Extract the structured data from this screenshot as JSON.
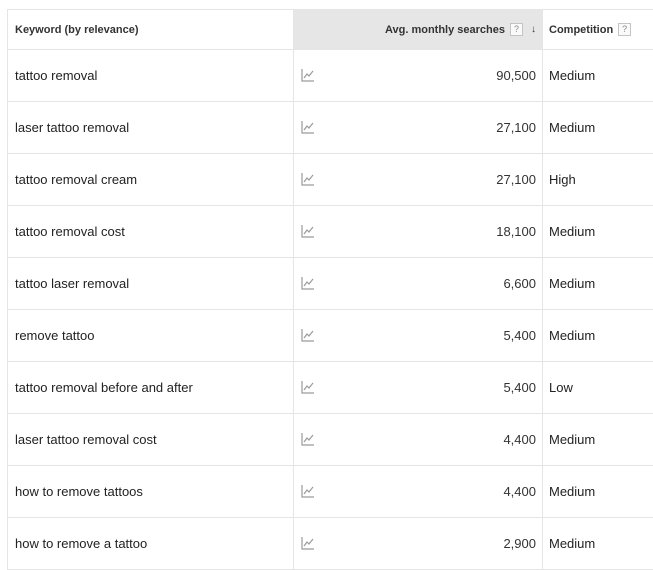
{
  "header": {
    "keyword_col": "Keyword (by relevance)",
    "searches_col": "Avg. monthly searches",
    "competition_col": "Competition",
    "help_glyph": "?",
    "sort_glyph": "↓"
  },
  "rows": [
    {
      "keyword": "tattoo removal",
      "searches": "90,500",
      "competition": "Medium"
    },
    {
      "keyword": "laser tattoo removal",
      "searches": "27,100",
      "competition": "Medium"
    },
    {
      "keyword": "tattoo removal cream",
      "searches": "27,100",
      "competition": "High"
    },
    {
      "keyword": "tattoo removal cost",
      "searches": "18,100",
      "competition": "Medium"
    },
    {
      "keyword": "tattoo laser removal",
      "searches": "6,600",
      "competition": "Medium"
    },
    {
      "keyword": "remove tattoo",
      "searches": "5,400",
      "competition": "Medium"
    },
    {
      "keyword": "tattoo removal before and after",
      "searches": "5,400",
      "competition": "Low"
    },
    {
      "keyword": "laser tattoo removal cost",
      "searches": "4,400",
      "competition": "Medium"
    },
    {
      "keyword": "how to remove tattoos",
      "searches": "4,400",
      "competition": "Medium"
    },
    {
      "keyword": "how to remove a tattoo",
      "searches": "2,900",
      "competition": "Medium"
    }
  ],
  "icons": {
    "trend": "line-chart-icon",
    "help": "help-icon",
    "sort": "sort-descending-icon"
  }
}
